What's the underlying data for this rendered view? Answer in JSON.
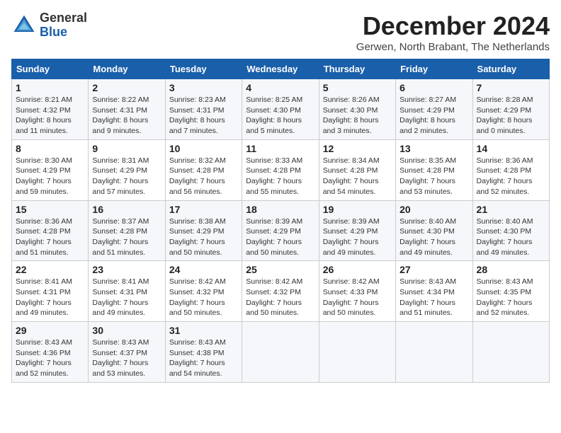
{
  "header": {
    "logo_general": "General",
    "logo_blue": "Blue",
    "title": "December 2024",
    "location": "Gerwen, North Brabant, The Netherlands"
  },
  "weekdays": [
    "Sunday",
    "Monday",
    "Tuesday",
    "Wednesday",
    "Thursday",
    "Friday",
    "Saturday"
  ],
  "weeks": [
    [
      {
        "day": "1",
        "sunrise": "8:21 AM",
        "sunset": "4:32 PM",
        "daylight": "8 hours and 11 minutes."
      },
      {
        "day": "2",
        "sunrise": "8:22 AM",
        "sunset": "4:31 PM",
        "daylight": "8 hours and 9 minutes."
      },
      {
        "day": "3",
        "sunrise": "8:23 AM",
        "sunset": "4:31 PM",
        "daylight": "8 hours and 7 minutes."
      },
      {
        "day": "4",
        "sunrise": "8:25 AM",
        "sunset": "4:30 PM",
        "daylight": "8 hours and 5 minutes."
      },
      {
        "day": "5",
        "sunrise": "8:26 AM",
        "sunset": "4:30 PM",
        "daylight": "8 hours and 3 minutes."
      },
      {
        "day": "6",
        "sunrise": "8:27 AM",
        "sunset": "4:29 PM",
        "daylight": "8 hours and 2 minutes."
      },
      {
        "day": "7",
        "sunrise": "8:28 AM",
        "sunset": "4:29 PM",
        "daylight": "8 hours and 0 minutes."
      }
    ],
    [
      {
        "day": "8",
        "sunrise": "8:30 AM",
        "sunset": "4:29 PM",
        "daylight": "7 hours and 59 minutes."
      },
      {
        "day": "9",
        "sunrise": "8:31 AM",
        "sunset": "4:29 PM",
        "daylight": "7 hours and 57 minutes."
      },
      {
        "day": "10",
        "sunrise": "8:32 AM",
        "sunset": "4:28 PM",
        "daylight": "7 hours and 56 minutes."
      },
      {
        "day": "11",
        "sunrise": "8:33 AM",
        "sunset": "4:28 PM",
        "daylight": "7 hours and 55 minutes."
      },
      {
        "day": "12",
        "sunrise": "8:34 AM",
        "sunset": "4:28 PM",
        "daylight": "7 hours and 54 minutes."
      },
      {
        "day": "13",
        "sunrise": "8:35 AM",
        "sunset": "4:28 PM",
        "daylight": "7 hours and 53 minutes."
      },
      {
        "day": "14",
        "sunrise": "8:36 AM",
        "sunset": "4:28 PM",
        "daylight": "7 hours and 52 minutes."
      }
    ],
    [
      {
        "day": "15",
        "sunrise": "8:36 AM",
        "sunset": "4:28 PM",
        "daylight": "7 hours and 51 minutes."
      },
      {
        "day": "16",
        "sunrise": "8:37 AM",
        "sunset": "4:28 PM",
        "daylight": "7 hours and 51 minutes."
      },
      {
        "day": "17",
        "sunrise": "8:38 AM",
        "sunset": "4:29 PM",
        "daylight": "7 hours and 50 minutes."
      },
      {
        "day": "18",
        "sunrise": "8:39 AM",
        "sunset": "4:29 PM",
        "daylight": "7 hours and 50 minutes."
      },
      {
        "day": "19",
        "sunrise": "8:39 AM",
        "sunset": "4:29 PM",
        "daylight": "7 hours and 49 minutes."
      },
      {
        "day": "20",
        "sunrise": "8:40 AM",
        "sunset": "4:30 PM",
        "daylight": "7 hours and 49 minutes."
      },
      {
        "day": "21",
        "sunrise": "8:40 AM",
        "sunset": "4:30 PM",
        "daylight": "7 hours and 49 minutes."
      }
    ],
    [
      {
        "day": "22",
        "sunrise": "8:41 AM",
        "sunset": "4:31 PM",
        "daylight": "7 hours and 49 minutes."
      },
      {
        "day": "23",
        "sunrise": "8:41 AM",
        "sunset": "4:31 PM",
        "daylight": "7 hours and 49 minutes."
      },
      {
        "day": "24",
        "sunrise": "8:42 AM",
        "sunset": "4:32 PM",
        "daylight": "7 hours and 50 minutes."
      },
      {
        "day": "25",
        "sunrise": "8:42 AM",
        "sunset": "4:32 PM",
        "daylight": "7 hours and 50 minutes."
      },
      {
        "day": "26",
        "sunrise": "8:42 AM",
        "sunset": "4:33 PM",
        "daylight": "7 hours and 50 minutes."
      },
      {
        "day": "27",
        "sunrise": "8:43 AM",
        "sunset": "4:34 PM",
        "daylight": "7 hours and 51 minutes."
      },
      {
        "day": "28",
        "sunrise": "8:43 AM",
        "sunset": "4:35 PM",
        "daylight": "7 hours and 52 minutes."
      }
    ],
    [
      {
        "day": "29",
        "sunrise": "8:43 AM",
        "sunset": "4:36 PM",
        "daylight": "7 hours and 52 minutes."
      },
      {
        "day": "30",
        "sunrise": "8:43 AM",
        "sunset": "4:37 PM",
        "daylight": "7 hours and 53 minutes."
      },
      {
        "day": "31",
        "sunrise": "8:43 AM",
        "sunset": "4:38 PM",
        "daylight": "7 hours and 54 minutes."
      },
      null,
      null,
      null,
      null
    ]
  ]
}
